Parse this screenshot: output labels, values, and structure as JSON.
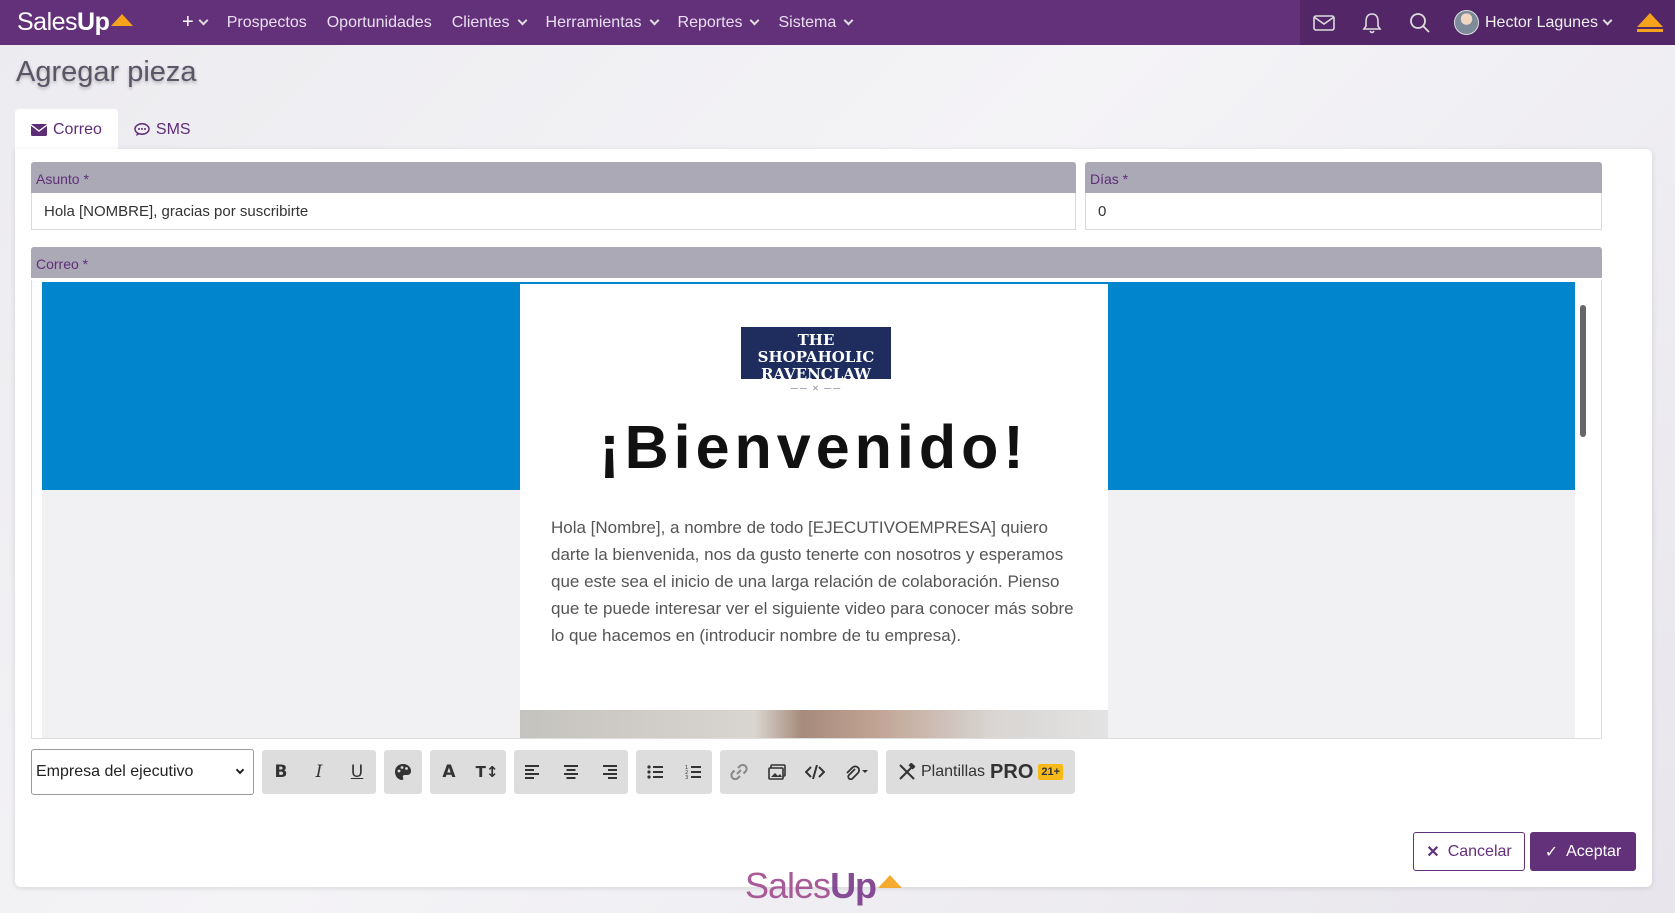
{
  "brand": {
    "part1": "Sales",
    "part2": "Up"
  },
  "nav": {
    "items": [
      {
        "label": "Prospectos",
        "dropdown": false
      },
      {
        "label": "Oportunidades",
        "dropdown": false
      },
      {
        "label": "Clientes",
        "dropdown": true
      },
      {
        "label": "Herramientas",
        "dropdown": true
      },
      {
        "label": "Reportes",
        "dropdown": true
      },
      {
        "label": "Sistema",
        "dropdown": true
      }
    ],
    "user_name": "Hector Lagunes"
  },
  "page": {
    "title": "Agregar pieza"
  },
  "tabs": [
    {
      "label": "Correo",
      "icon": "envelope-icon",
      "active": true
    },
    {
      "label": "SMS",
      "icon": "chat-icon",
      "active": false
    }
  ],
  "form": {
    "subject_label": "Asunto *",
    "subject_value": "Hola [NOMBRE], gracias por suscribirte",
    "days_label": "Días *",
    "days_value": "0",
    "email_label": "Correo *"
  },
  "email_preview": {
    "logo_line1": "THE SHOPAHOLIC",
    "logo_line2": "RAVENCLAW",
    "heading": "¡Bienvenido!",
    "body": "Hola [Nombre], a nombre de todo [EJECUTIVOEMPRESA] quiero darte la bienvenida, nos da gusto tenerte con nosotros y esperamos que este sea el inicio de una larga relación de colaboración. Pienso que te puede interesar ver el siguiente video para conocer más sobre lo que hacemos en (introducir nombre de tu empresa)."
  },
  "toolbar": {
    "select_value": "Empresa del ejecutivo",
    "templates_label": "Plantillas",
    "templates_pro": "PRO",
    "templates_badge": "21+"
  },
  "actions": {
    "cancel": "Cancelar",
    "accept": "Aceptar"
  },
  "colors": {
    "primary": "#63307a",
    "accent": "#f5a31a",
    "email_band": "#0185cc"
  }
}
